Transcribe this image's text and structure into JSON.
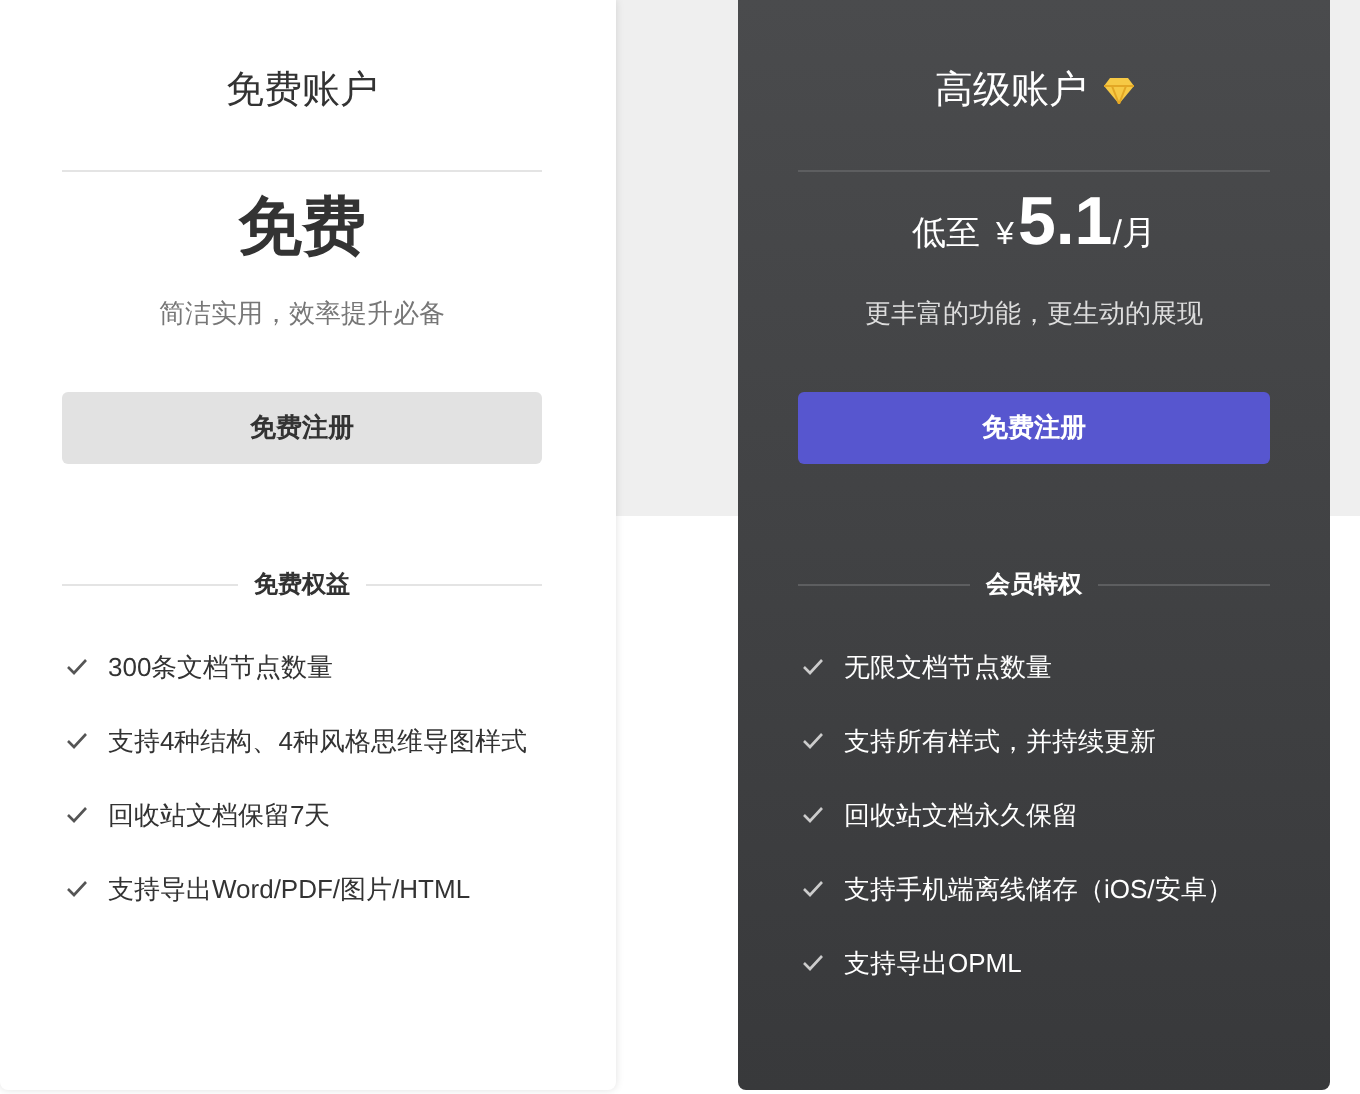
{
  "plans": [
    {
      "kind": "free",
      "title": "免费账户",
      "price": {
        "main": "免费"
      },
      "subtitle": "简洁实用，效率提升必备",
      "button": "免费注册",
      "section": "免费权益",
      "features": [
        "300条文档节点数量",
        "支持4种结构、4种风格思维导图样式",
        "回收站文档保留7天",
        "支持导出Word/PDF/图片/HTML"
      ]
    },
    {
      "kind": "premium",
      "title": "高级账户",
      "price": {
        "prefix": "低至",
        "currency": "¥",
        "main": "5.1",
        "suffix": "/月"
      },
      "subtitle": "更丰富的功能，更生动的展现",
      "button": "免费注册",
      "section": "会员特权",
      "features": [
        "无限文档节点数量",
        "支持所有样式，并持续更新",
        "回收站文档永久保留",
        "支持手机端离线储存（iOS/安卓）",
        "支持导出OPML"
      ]
    }
  ]
}
